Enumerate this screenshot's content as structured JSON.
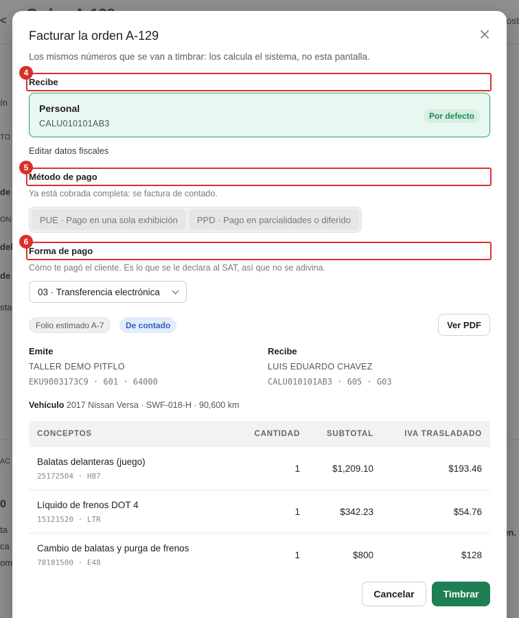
{
  "background": {
    "title": "Orden A-129",
    "back_glyph": "<",
    "right_text": "ost",
    "left_fragments": [
      "ín",
      "TO",
      "de",
      "ON",
      "del",
      "de",
      "sta",
      "AC",
      "0",
      "ta",
      "ca",
      "om"
    ],
    "right_fragment": "en."
  },
  "modal": {
    "title": "Facturar la orden A-129",
    "subtitle": "Los mismos números que se van a timbrar: los calcula el sistema, no esta pantalla.",
    "close_label": "×"
  },
  "annotations": [
    "4",
    "5",
    "6"
  ],
  "recibe": {
    "label": "Recibe",
    "card": {
      "name": "Personal",
      "rfc": "CALU010101AB3",
      "badge": "Por defecto"
    },
    "edit_link": "Editar datos fiscales"
  },
  "metodo": {
    "label": "Método de pago",
    "help": "Ya está cobrada completa: se factura de contado.",
    "options": [
      "PUE · Pago en una sola exhibición",
      "PPD · Pago en parcialidades o diferido"
    ]
  },
  "forma": {
    "label": "Forma de pago",
    "help": "Cómo te pagó el cliente. Es lo que se le declara al SAT, así que no se adivina.",
    "selected": "03 · Transferencia electrónica"
  },
  "preview": {
    "folio": "Folio estimado A-7",
    "contado": "De contado",
    "pdf_button": "Ver PDF",
    "emite": {
      "heading": "Emite",
      "name": "TALLER DEMO PITFLO",
      "meta": "EKU9003173C9 · 601 · 64000"
    },
    "recibe": {
      "heading": "Recibe",
      "name": "LUIS EDUARDO CHAVEZ",
      "meta": "CALU010101AB3 · 605 · G03"
    },
    "vehiculo_label": "Vehículo",
    "vehiculo_value": "2017 Nissan Versa · SWF-018-H · 90,600 km"
  },
  "table": {
    "headers": [
      "CONCEPTOS",
      "CANTIDAD",
      "SUBTOTAL",
      "IVA TRASLADADO"
    ],
    "rows": [
      {
        "desc": "Balatas delanteras (juego)",
        "code": "25172504 · H87",
        "qty": "1",
        "subtotal": "$1,209.10",
        "iva": "$193.46"
      },
      {
        "desc": "Líquido de frenos DOT 4",
        "code": "15121520 · LTR",
        "qty": "1",
        "subtotal": "$342.23",
        "iva": "$54.76"
      },
      {
        "desc": "Cambio de balatas y purga de frenos",
        "code": "78181500 · E48",
        "qty": "1",
        "subtotal": "$800",
        "iva": "$128"
      }
    ]
  },
  "footer": {
    "cancel": "Cancelar",
    "submit": "Timbrar"
  },
  "colors": {
    "accent_green": "#1e7f55",
    "card_border": "#29a36a",
    "annotation_red": "#d9302c",
    "contado_blue": "#2a5fc0"
  }
}
